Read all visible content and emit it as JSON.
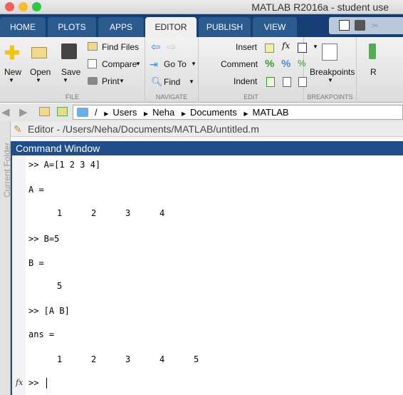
{
  "window": {
    "title": "MATLAB R2016a - student use"
  },
  "tabs": [
    {
      "label": "HOME"
    },
    {
      "label": "PLOTS"
    },
    {
      "label": "APPS"
    },
    {
      "label": "EDITOR",
      "active": true
    },
    {
      "label": "PUBLISH"
    },
    {
      "label": "VIEW"
    }
  ],
  "ribbon": {
    "file": {
      "label": "FILE",
      "new": "New",
      "open": "Open",
      "save": "Save",
      "find_files": "Find Files",
      "compare": "Compare",
      "print": "Print"
    },
    "navigate": {
      "label": "NAVIGATE",
      "go_to": "Go To",
      "find": "Find"
    },
    "edit": {
      "label": "EDIT",
      "insert": "Insert",
      "comment": "Comment",
      "indent": "Indent",
      "fx": "fx"
    },
    "breakpoints": {
      "label": "BREAKPOINTS",
      "button": "Breakpoints"
    },
    "run_partial": "R"
  },
  "address": {
    "path": [
      "/",
      "Users",
      "Neha",
      "Documents",
      "MATLAB"
    ]
  },
  "editor": {
    "title": "Editor - /Users/Neha/Documents/MATLAB/untitled.m"
  },
  "sidebar": {
    "label": "Current Folder"
  },
  "command_window": {
    "title": "Command Window",
    "lines": [
      ">> A=[1 2 3 4]",
      "A =",
      ">> B=5",
      "B =",
      ">> [A B]",
      "ans =",
      ">> "
    ],
    "A_values": [
      "1",
      "2",
      "3",
      "4"
    ],
    "B_values": [
      "5"
    ],
    "ans_values": [
      "1",
      "2",
      "3",
      "4",
      "5"
    ],
    "prompt_icon": "fx"
  },
  "colors": {
    "tabbar": "#153f74",
    "header": "#1f4e8a"
  }
}
